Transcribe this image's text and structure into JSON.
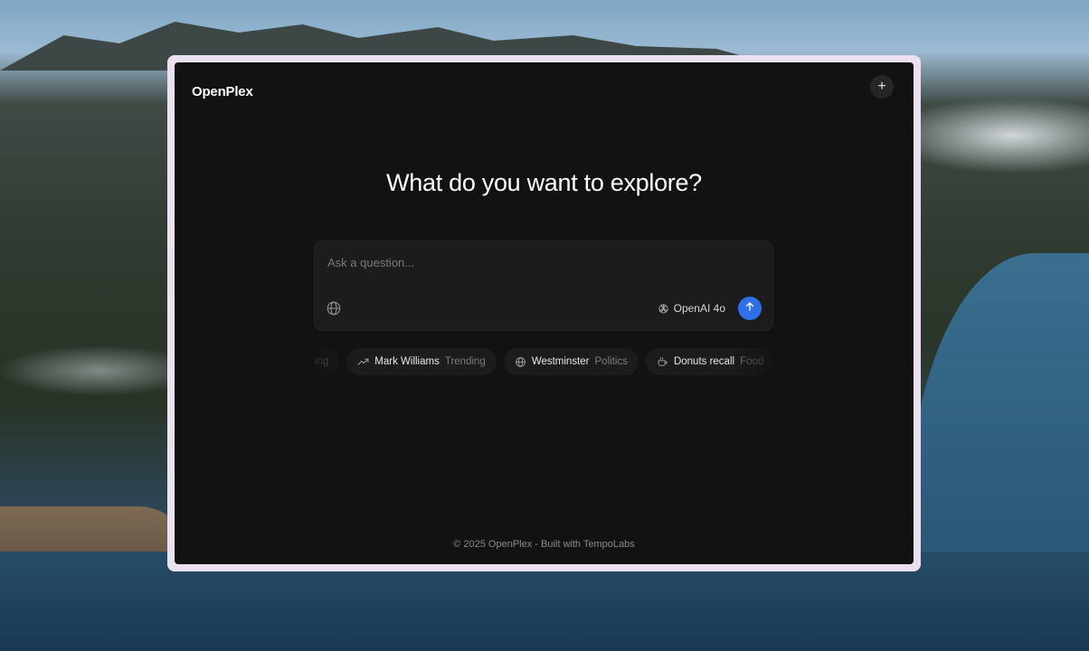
{
  "app": {
    "brand": "OpenPlex",
    "new_chat_label": "+"
  },
  "main": {
    "headline": "What do you want to explore?"
  },
  "composer": {
    "placeholder": "Ask a question...",
    "value": "",
    "model_label": "OpenAI 4o",
    "globe_icon": "globe-icon",
    "model_icon": "openai-icon",
    "send_icon": "arrow-up-icon"
  },
  "suggestions": [
    {
      "title": "",
      "category": "Gaming",
      "icon": "gamepad-icon"
    },
    {
      "title": "Mark Williams",
      "category": "Trending",
      "icon": "trending-up-icon"
    },
    {
      "title": "Westminster",
      "category": "Politics",
      "icon": "globe-icon"
    },
    {
      "title": "Donuts recall",
      "category": "Food",
      "icon": "coffee-icon"
    }
  ],
  "footer": {
    "text": "© 2025 OpenPlex - Built with TempoLabs"
  },
  "colors": {
    "accent": "#2f6fe8",
    "window_bg": "#121212",
    "frame": "#eae0f0"
  }
}
